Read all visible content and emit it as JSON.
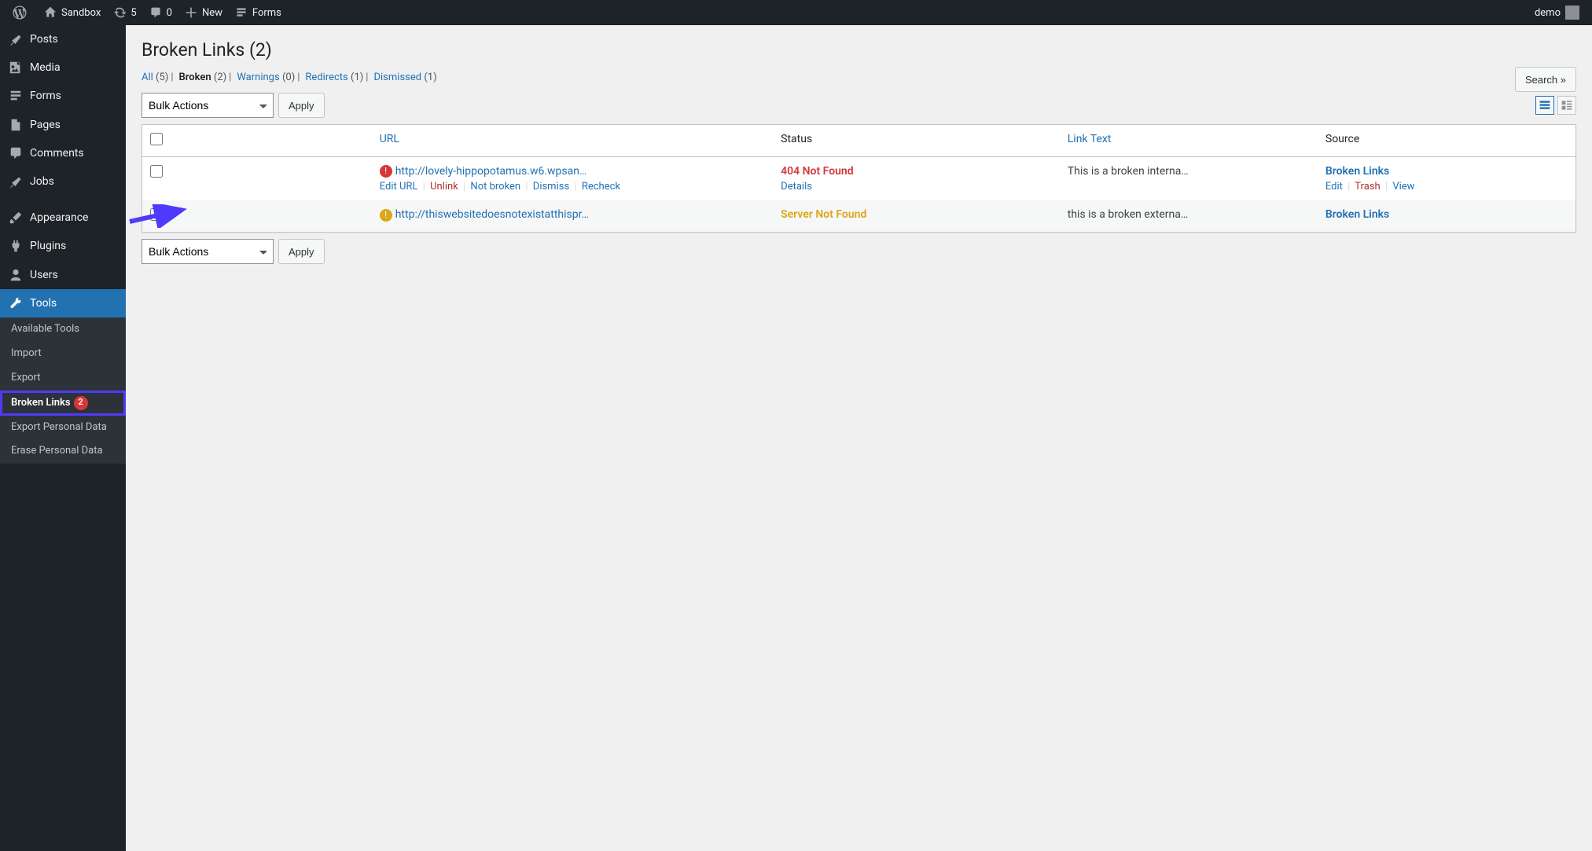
{
  "adminbar": {
    "site_name": "Sandbox",
    "updates_count": "5",
    "comments_count": "0",
    "new_label": "New",
    "forms_label": "Forms",
    "howdy_user": "demo"
  },
  "sidebar": {
    "items": [
      {
        "label": "Posts",
        "icon": "pin"
      },
      {
        "label": "Media",
        "icon": "media"
      },
      {
        "label": "Forms",
        "icon": "forms"
      },
      {
        "label": "Pages",
        "icon": "page"
      },
      {
        "label": "Comments",
        "icon": "comment"
      },
      {
        "label": "Jobs",
        "icon": "pin"
      },
      {
        "label": "Appearance",
        "icon": "brush"
      },
      {
        "label": "Plugins",
        "icon": "plugin"
      },
      {
        "label": "Users",
        "icon": "user"
      },
      {
        "label": "Tools",
        "icon": "tools",
        "current": true
      }
    ],
    "submenu": [
      {
        "label": "Available Tools"
      },
      {
        "label": "Import"
      },
      {
        "label": "Export"
      },
      {
        "label": "Broken Links",
        "current": true,
        "badge": "2",
        "highlighted": true
      },
      {
        "label": "Export Personal Data"
      },
      {
        "label": "Erase Personal Data"
      }
    ]
  },
  "page": {
    "title": "Broken Links (2)",
    "search_button": "Search »",
    "bulk_actions_label": "Bulk Actions",
    "apply_label": "Apply"
  },
  "filters": [
    {
      "label": "All",
      "count": "(5)"
    },
    {
      "label": "Broken",
      "count": "(2)",
      "current": true
    },
    {
      "label": "Warnings",
      "count": "(0)"
    },
    {
      "label": "Redirects",
      "count": "(1)"
    },
    {
      "label": "Dismissed",
      "count": "(1)"
    }
  ],
  "columns": {
    "url": "URL",
    "status": "Status",
    "link_text": "Link Text",
    "source": "Source"
  },
  "row_actions": {
    "edit_url": "Edit URL",
    "unlink": "Unlink",
    "not_broken": "Not broken",
    "dismiss": "Dismiss",
    "recheck": "Recheck",
    "details": "Details",
    "edit": "Edit",
    "trash": "Trash",
    "view": "View"
  },
  "rows": [
    {
      "icon": "error",
      "url": "http://lovely-hippopotamus.w6.wpsan…",
      "status_label": "404 Not Found",
      "status_class": "status-404",
      "link_text": "This is a broken interna…",
      "source": "Broken Links",
      "show_actions": true
    },
    {
      "icon": "warn",
      "url": "http://thiswebsitedoesnotexistatthispr…",
      "status_label": "Server Not Found",
      "status_class": "status-server",
      "link_text": "this is a broken externa…",
      "source": "Broken Links",
      "show_actions": false
    }
  ]
}
